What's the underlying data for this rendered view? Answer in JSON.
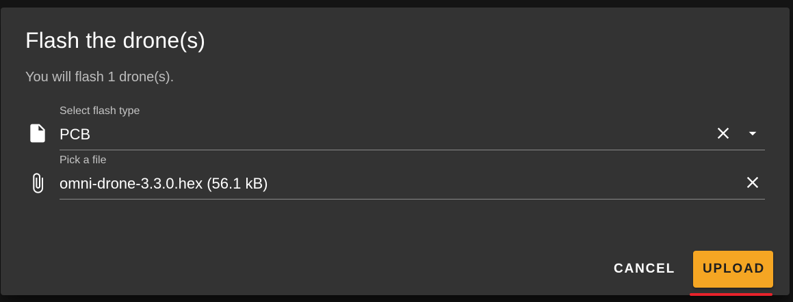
{
  "dialog": {
    "title": "Flash the drone(s)",
    "subtitle": "You will flash 1 drone(s)."
  },
  "flash_type": {
    "label": "Select flash type",
    "value": "PCB",
    "icon": "file-icon",
    "clear_icon": "close-icon",
    "dropdown_icon": "caret-down-icon"
  },
  "file_picker": {
    "label": "Pick a file",
    "value": "omni-drone-3.3.0.hex (56.1 kB)",
    "icon": "paperclip-icon",
    "clear_icon": "close-icon"
  },
  "actions": {
    "cancel_label": "CANCEL",
    "upload_label": "UPLOAD"
  },
  "colors": {
    "dialog_bg": "#333333",
    "accent": "#f5a623",
    "focus_indicator": "#e8232b",
    "backdrop": "#151515"
  }
}
